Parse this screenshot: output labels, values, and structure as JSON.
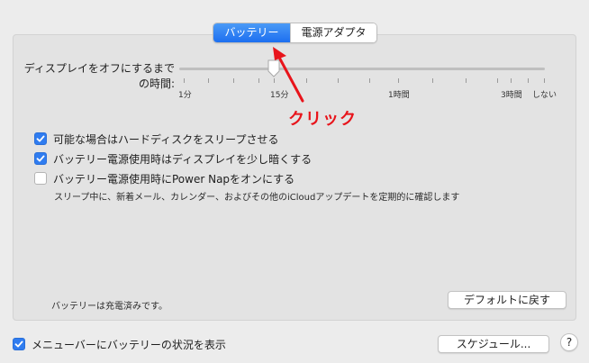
{
  "tabs": {
    "battery": "バッテリー",
    "power_adapter": "電源アダプタ"
  },
  "display_sleep": {
    "label_line1": "ディスプレイをオフにするまで",
    "label_line2": "の時間:",
    "ticks": {
      "t1": "1分",
      "t2": "15分",
      "t3": "1時間",
      "t4": "3時間",
      "t5": "しない"
    }
  },
  "annotation": {
    "text": "クリック",
    "color": "#e8141b"
  },
  "options": {
    "hdd_sleep": "可能な場合はハードディスクをスリープさせる",
    "dim_display": "バッテリー電源使用時はディスプレイを少し暗くする",
    "power_nap": "バッテリー電源使用時にPower Napをオンにする",
    "power_nap_note": "スリープ中に、新着メール、カレンダー、およびその他のiCloudアップデートを定期的に確認します"
  },
  "status": {
    "text": "バッテリーは充電済みです。"
  },
  "buttons": {
    "restore_defaults": "デフォルトに戻す",
    "schedule": "スケジュール...",
    "help": "?"
  },
  "menubar_option": {
    "label": "メニューバーにバッテリーの状況を表示"
  },
  "colors": {
    "accent": "#2f7cf0"
  }
}
